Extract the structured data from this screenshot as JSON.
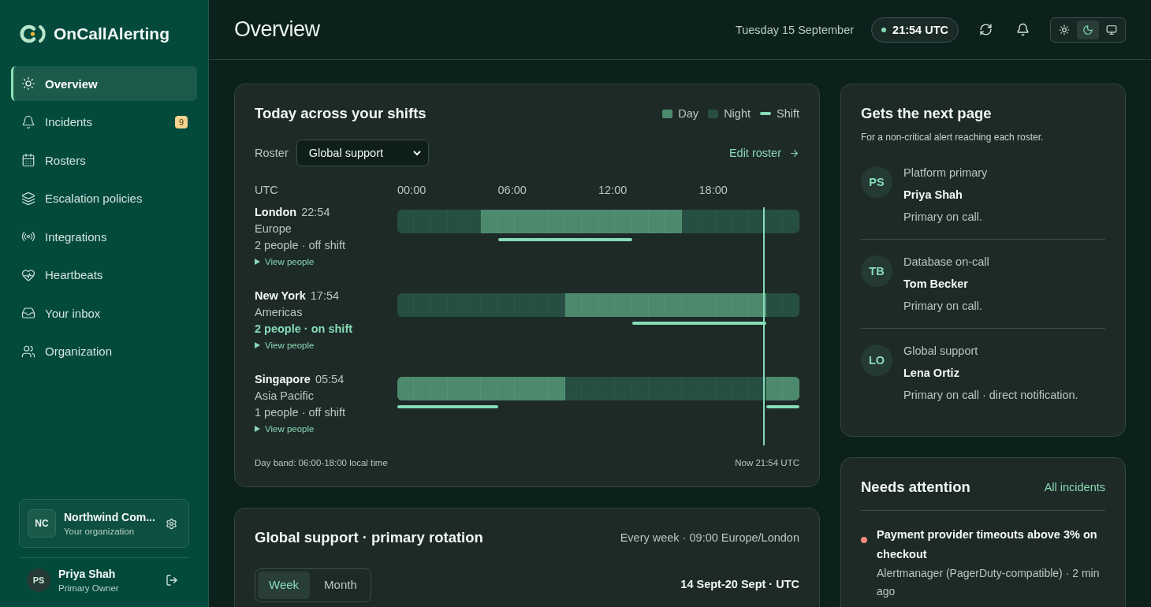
{
  "brand": {
    "name": "OnCallAlerting"
  },
  "nav": [
    {
      "label": "Overview",
      "selected": true
    },
    {
      "label": "Incidents",
      "selected": false,
      "badge": "9"
    },
    {
      "label": "Rosters",
      "selected": false
    },
    {
      "label": "Escalation policies",
      "selected": false
    },
    {
      "label": "Integrations",
      "selected": false
    },
    {
      "label": "Heartbeats",
      "selected": false
    },
    {
      "label": "Your inbox",
      "selected": false
    },
    {
      "label": "Organization",
      "selected": false
    }
  ],
  "organization": {
    "initials": "NC",
    "name": "Northwind Com...",
    "subtitle": "Your organization"
  },
  "user": {
    "initials": "PS",
    "name": "Priya Shah",
    "role": "Primary Owner"
  },
  "header": {
    "title": "Overview",
    "date": "Tuesday 15 September",
    "time": "21:54 UTC",
    "themes": [
      {
        "selected": false
      },
      {
        "selected": true
      },
      {
        "selected": false
      }
    ]
  },
  "shifts_card": {
    "title": "Today across your shifts",
    "legend": [
      {
        "label": "Day",
        "kind": "day"
      },
      {
        "label": "Night",
        "kind": "night"
      },
      {
        "label": "Shift",
        "kind": "shift"
      }
    ],
    "roster_label": "Roster",
    "roster_value": "Global support",
    "edit_link": "Edit roster",
    "axis_label": "UTC",
    "ticks": [
      "00:00",
      "06:00",
      "12:00",
      "18:00"
    ],
    "now_marker": {
      "level": 0.912
    },
    "rows": [
      {
        "city": "London",
        "local_time": "22:54",
        "region": "Europe",
        "status": "2 people · off shift",
        "on_shift": false,
        "toggle": "View people",
        "hours": [
          {
            "day": false,
            "shift": false
          },
          {
            "day": false,
            "shift": false
          },
          {
            "day": false,
            "shift": false
          },
          {
            "day": false,
            "shift": false
          },
          {
            "day": false,
            "shift": false
          },
          {
            "day": true,
            "shift": false
          },
          {
            "day": true,
            "shift": true
          },
          {
            "day": true,
            "shift": true
          },
          {
            "day": true,
            "shift": true
          },
          {
            "day": true,
            "shift": true
          },
          {
            "day": true,
            "shift": true
          },
          {
            "day": true,
            "shift": true
          },
          {
            "day": true,
            "shift": true
          },
          {
            "day": true,
            "shift": true
          },
          {
            "day": true,
            "shift": false
          },
          {
            "day": true,
            "shift": false
          },
          {
            "day": true,
            "shift": false
          },
          {
            "day": false,
            "shift": false
          },
          {
            "day": false,
            "shift": false
          },
          {
            "day": false,
            "shift": false
          },
          {
            "day": false,
            "shift": false
          },
          {
            "day": false,
            "shift": false
          },
          {
            "day": false,
            "shift": false
          },
          {
            "day": false,
            "shift": false
          }
        ]
      },
      {
        "city": "New York",
        "local_time": "17:54",
        "region": "Americas",
        "status": "2 people · on shift",
        "on_shift": true,
        "toggle": "View people",
        "hours": [
          {
            "day": false,
            "shift": false
          },
          {
            "day": false,
            "shift": false
          },
          {
            "day": false,
            "shift": false
          },
          {
            "day": false,
            "shift": false
          },
          {
            "day": false,
            "shift": false
          },
          {
            "day": false,
            "shift": false
          },
          {
            "day": false,
            "shift": false
          },
          {
            "day": false,
            "shift": false
          },
          {
            "day": false,
            "shift": false
          },
          {
            "day": false,
            "shift": false
          },
          {
            "day": true,
            "shift": false
          },
          {
            "day": true,
            "shift": false
          },
          {
            "day": true,
            "shift": false
          },
          {
            "day": true,
            "shift": false
          },
          {
            "day": true,
            "shift": true
          },
          {
            "day": true,
            "shift": true
          },
          {
            "day": true,
            "shift": true
          },
          {
            "day": true,
            "shift": true
          },
          {
            "day": true,
            "shift": true
          },
          {
            "day": true,
            "shift": true
          },
          {
            "day": true,
            "shift": true
          },
          {
            "day": true,
            "shift": true
          },
          {
            "day": false,
            "shift": false
          },
          {
            "day": false,
            "shift": false
          }
        ]
      },
      {
        "city": "Singapore",
        "local_time": "05:54",
        "region": "Asia Pacific",
        "status": "1 people · off shift",
        "on_shift": false,
        "toggle": "View people",
        "hours": [
          {
            "day": true,
            "shift": true
          },
          {
            "day": true,
            "shift": true
          },
          {
            "day": true,
            "shift": true
          },
          {
            "day": true,
            "shift": true
          },
          {
            "day": true,
            "shift": true
          },
          {
            "day": true,
            "shift": true
          },
          {
            "day": true,
            "shift": false
          },
          {
            "day": true,
            "shift": false
          },
          {
            "day": true,
            "shift": false
          },
          {
            "day": true,
            "shift": false
          },
          {
            "day": false,
            "shift": false
          },
          {
            "day": false,
            "shift": false
          },
          {
            "day": false,
            "shift": false
          },
          {
            "day": false,
            "shift": false
          },
          {
            "day": false,
            "shift": false
          },
          {
            "day": false,
            "shift": false
          },
          {
            "day": false,
            "shift": false
          },
          {
            "day": false,
            "shift": false
          },
          {
            "day": false,
            "shift": false
          },
          {
            "day": false,
            "shift": false
          },
          {
            "day": false,
            "shift": false
          },
          {
            "day": false,
            "shift": false
          },
          {
            "day": true,
            "shift": true
          },
          {
            "day": true,
            "shift": true
          }
        ]
      }
    ],
    "footnote": "Day band: 06:00-18:00 local time",
    "now_label": "Now 21:54 UTC"
  },
  "rotation_card": {
    "title": "Global support · primary rotation",
    "schedule": "Every week · 09:00 Europe/London",
    "tabs": [
      {
        "label": "Week",
        "selected": true
      },
      {
        "label": "Month",
        "selected": false
      }
    ],
    "range": "14 Sept-20 Sept · UTC"
  },
  "next_page_card": {
    "title": "Gets the next page",
    "subtitle": "For a non-critical alert reaching each roster.",
    "people": [
      {
        "initials": "PS",
        "roster": "Platform primary",
        "name": "Priya Shah",
        "note": "Primary on call."
      },
      {
        "initials": "TB",
        "roster": "Database on-call",
        "name": "Tom Becker",
        "note": "Primary on call."
      },
      {
        "initials": "LO",
        "roster": "Global support",
        "name": "Lena Ortiz",
        "note": "Primary on call · direct notification."
      }
    ]
  },
  "attention_card": {
    "title": "Needs attention",
    "link": "All incidents",
    "incidents": [
      {
        "title": "Payment provider timeouts above 3% on checkout",
        "meta": "Alertmanager (PagerDuty-compatible) · 2 min ago",
        "color": "#f28b7a"
      }
    ]
  }
}
